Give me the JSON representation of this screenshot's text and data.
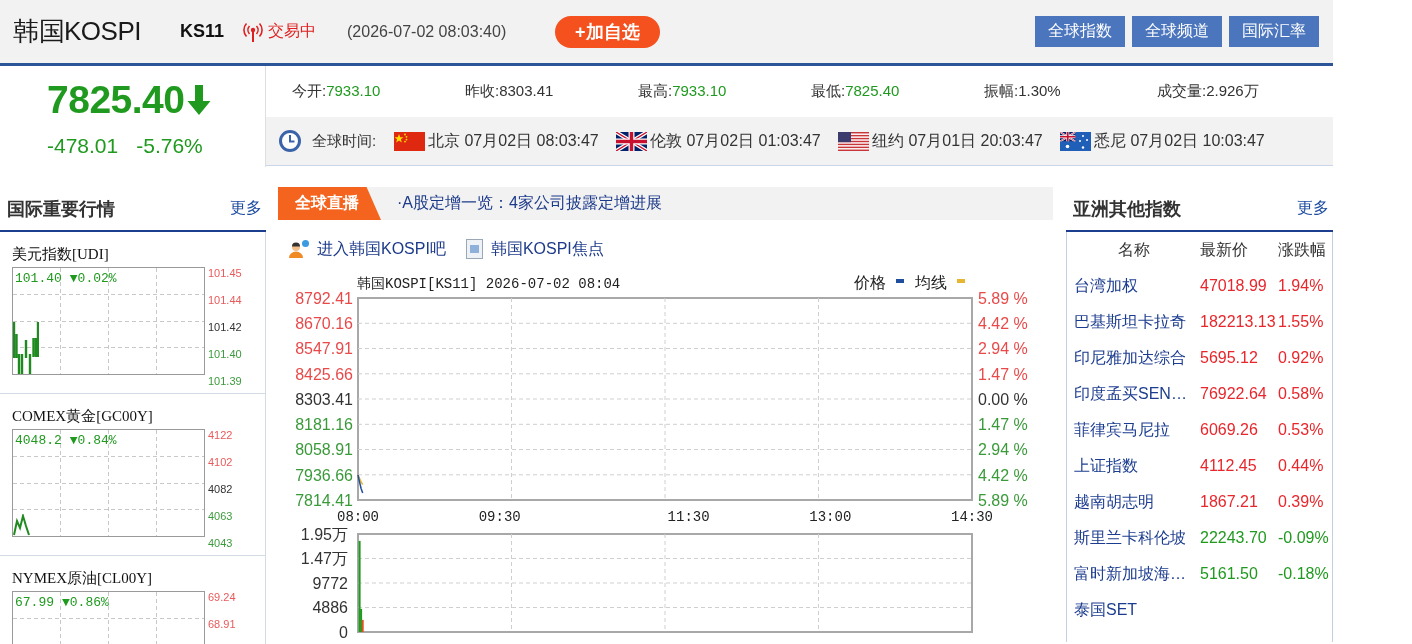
{
  "header": {
    "title": "韩国KOSPI",
    "code": "KS11",
    "status": "交易中",
    "timestamp": "(2026-07-02 08:03:40)",
    "watch_button": "+加自选",
    "nav_buttons": [
      "全球指数",
      "全球频道",
      "国际汇率"
    ]
  },
  "quote": {
    "price": "7825.40",
    "falling": true,
    "change": "-478.01",
    "change_percent": "-5.76%"
  },
  "stats": [
    {
      "label": "今开:",
      "value": "7933.10",
      "color": "#1f9a1f"
    },
    {
      "label": "昨收:",
      "value": "8303.41",
      "color": "#333333"
    },
    {
      "label": "最高:",
      "value": "7933.10",
      "color": "#1f9a1f"
    },
    {
      "label": "最低:",
      "value": "7825.40",
      "color": "#1f9a1f"
    },
    {
      "label": "振幅:",
      "value": "1.30%",
      "color": "#333333"
    },
    {
      "label": "成交量:",
      "value": "2.926万",
      "color": "#333333"
    }
  ],
  "world_clock": {
    "label": "全球时间:",
    "cities": [
      {
        "kind": "china",
        "text": "北京 07月02日 08:03:47"
      },
      {
        "kind": "uk",
        "text": "伦敦 07月02日 01:03:47"
      },
      {
        "kind": "us",
        "text": "纽约 07月01日 20:03:47"
      },
      {
        "kind": "australia",
        "text": "悉尼 07月02日 10:03:47"
      }
    ]
  },
  "markets_panel": {
    "title": "国际重要行情",
    "more": "更多",
    "cards": [
      {
        "name": "美元指数[UDI]",
        "price": "101.40",
        "change": "▼0.02%",
        "color": "#1f9a1f",
        "kind": "bars",
        "ticks": [
          {
            "label": "101.45",
            "color": "#e85a5a"
          },
          {
            "label": "101.44",
            "color": "#e85a5a"
          },
          {
            "label": "101.42",
            "color": "#333333"
          },
          {
            "label": "101.40",
            "color": "#3d9a3d"
          },
          {
            "label": "101.39",
            "color": "#3d9a3d"
          }
        ]
      },
      {
        "name": "COMEX黄金[GC00Y]",
        "price": "4048.2",
        "change": "▼0.84%",
        "color": "#1f9a1f",
        "kind": "line",
        "ticks": [
          {
            "label": "4122",
            "color": "#e85a5a"
          },
          {
            "label": "4102",
            "color": "#e85a5a"
          },
          {
            "label": "4082",
            "color": "#333333"
          },
          {
            "label": "4063",
            "color": "#3d9a3d"
          },
          {
            "label": "4043",
            "color": "#3d9a3d"
          }
        ]
      },
      {
        "name": "NYMEX原油[CL00Y]",
        "price": "67.99",
        "change": "▼0.86%",
        "color": "#1f9a1f",
        "kind": "empty",
        "ticks": [
          {
            "label": "69.24",
            "color": "#e85a5a"
          },
          {
            "label": "68.91",
            "color": "#e85a5a"
          }
        ]
      }
    ]
  },
  "news_bar": {
    "tag": "全球直播",
    "headline": "·A股定增一览：4家公司披露定增进展"
  },
  "links": [
    {
      "kind": "forum",
      "label": "进入韩国KOSPI吧"
    },
    {
      "kind": "news",
      "label": "韩国KOSPI焦点"
    }
  ],
  "price_chart": {
    "right_ticks": [
      "5.89 %",
      "4.42 %",
      "2.94 %",
      "1.47 %",
      "0.00 %",
      "1.47 %",
      "2.94 %",
      "4.42 %",
      "5.89 %"
    ],
    "chart_data": {
      "type": "line",
      "grid": true,
      "legend": "top-right",
      "title": "韩国KOSPI[KS11] 2026-07-02 08:04",
      "categories": [
        "08:00",
        null,
        null,
        null,
        null,
        null,
        null,
        null,
        null,
        null,
        null,
        null,
        null,
        null,
        null,
        null,
        null,
        null,
        null,
        null,
        null,
        null,
        null,
        null,
        null,
        null,
        null,
        null,
        null,
        null,
        null,
        null,
        null,
        null,
        null,
        null,
        null,
        null,
        null,
        null,
        null,
        null,
        null,
        null,
        null,
        null,
        null,
        null,
        null,
        null,
        null,
        null,
        null,
        null,
        null,
        null,
        null,
        null,
        null,
        null,
        null,
        null,
        null,
        null,
        null,
        null,
        null,
        null,
        null,
        null,
        null,
        null,
        null,
        null,
        null,
        null,
        null,
        null,
        null,
        null,
        null,
        null,
        null,
        null,
        null,
        null,
        null,
        null,
        null,
        null,
        "09:30",
        null,
        null,
        null,
        null,
        null,
        null,
        null,
        null,
        null,
        null,
        null,
        null,
        null,
        null,
        null,
        null,
        null,
        null,
        null,
        null,
        null,
        null,
        null,
        null,
        null,
        null,
        null,
        null,
        null,
        null,
        null,
        null,
        null,
        null,
        null,
        null,
        null,
        null,
        null,
        null,
        null,
        null,
        null,
        null,
        null,
        null,
        null,
        null,
        null,
        null,
        null,
        null,
        null,
        null,
        null,
        null,
        null,
        null,
        null,
        null,
        null,
        null,
        null,
        null,
        null,
        null,
        null,
        null,
        null,
        null,
        null,
        null,
        null,
        null,
        null,
        null,
        null,
        null,
        null,
        null,
        null,
        null,
        null,
        null,
        null,
        null,
        null,
        null,
        null,
        null,
        null,
        null,
        null,
        null,
        null,
        null,
        null,
        null,
        null,
        null,
        null,
        null,
        null,
        null,
        null,
        null,
        null,
        null,
        null,
        null,
        null,
        null,
        null,
        null,
        null,
        null,
        null,
        null,
        null,
        "11:30",
        null,
        null,
        null,
        null,
        null,
        null,
        null,
        null,
        null,
        null,
        null,
        null,
        null,
        null,
        null,
        null,
        null,
        null,
        null,
        null,
        null,
        null,
        null,
        null,
        null,
        null,
        null,
        null,
        null,
        null,
        null,
        null,
        null,
        null,
        null,
        null,
        null,
        null,
        null,
        null,
        null,
        null,
        null,
        null,
        null,
        null,
        null,
        null,
        null,
        null,
        null,
        null,
        null,
        null,
        null,
        null,
        null,
        null,
        null,
        null,
        null,
        null,
        null,
        null,
        null,
        null,
        null,
        null,
        null,
        null,
        null,
        null,
        null,
        null,
        null,
        null,
        null,
        null,
        null,
        null,
        null,
        null,
        null,
        null,
        null,
        null,
        null,
        null,
        null,
        "13:00",
        null,
        null,
        null,
        null,
        null,
        null,
        null,
        null,
        null,
        null,
        null,
        null,
        null,
        null,
        null,
        null,
        null,
        null,
        null,
        null,
        null,
        null,
        null,
        null,
        null,
        null,
        null,
        null,
        null,
        null,
        null,
        null,
        null,
        null,
        null,
        null,
        null,
        null,
        null,
        null,
        null,
        null,
        null,
        null,
        null,
        null,
        null,
        null,
        null,
        null,
        null,
        null,
        null,
        null,
        null,
        null,
        null,
        null,
        null,
        null,
        null,
        null,
        null,
        null,
        null,
        null,
        null,
        null,
        null,
        null,
        null,
        null,
        null,
        null,
        null,
        null,
        null,
        null,
        null,
        null,
        null,
        null,
        null,
        null,
        null,
        null,
        null,
        null,
        null,
        "14:30"
      ],
      "series": [
        {
          "name": "价格",
          "color": "#1f4e9e",
          "values": [
            7936,
            7900,
            7870,
            7848,
            null,
            null,
            null,
            null,
            null,
            null,
            null,
            null,
            null,
            null,
            null,
            null,
            null,
            null,
            null,
            null,
            null,
            null,
            null,
            null,
            null,
            null,
            null,
            null,
            null,
            null,
            null,
            null,
            null,
            null,
            null,
            null,
            null,
            null,
            null,
            null,
            null,
            null,
            null,
            null,
            null,
            null,
            null,
            null,
            null,
            null,
            null,
            null,
            null,
            null,
            null,
            null,
            null,
            null,
            null,
            null,
            null,
            null,
            null,
            null,
            null,
            null,
            null,
            null,
            null,
            null,
            null,
            null,
            null,
            null,
            null,
            null,
            null,
            null,
            null,
            null,
            null,
            null,
            null,
            null,
            null,
            null,
            null,
            null,
            null,
            null,
            null,
            null,
            null,
            null,
            null,
            null,
            null,
            null,
            null,
            null,
            null,
            null,
            null,
            null,
            null,
            null,
            null,
            null,
            null,
            null,
            null,
            null,
            null,
            null,
            null,
            null,
            null,
            null,
            null,
            null,
            null,
            null,
            null,
            null,
            null,
            null,
            null,
            null,
            null,
            null,
            null,
            null,
            null,
            null,
            null,
            null,
            null,
            null,
            null,
            null,
            null,
            null,
            null,
            null,
            null,
            null,
            null,
            null,
            null,
            null,
            null,
            null,
            null,
            null,
            null,
            null,
            null,
            null,
            null,
            null,
            null,
            null,
            null,
            null,
            null,
            null,
            null,
            null,
            null,
            null,
            null,
            null,
            null,
            null,
            null,
            null,
            null,
            null,
            null,
            null,
            null,
            null,
            null,
            null,
            null,
            null,
            null,
            null,
            null,
            null,
            null,
            null,
            null,
            null,
            null,
            null,
            null,
            null,
            null,
            null,
            null,
            null,
            null,
            null,
            null,
            null,
            null,
            null,
            null,
            null,
            null,
            null,
            null,
            null,
            null,
            null,
            null,
            null,
            null,
            null,
            null,
            null,
            null,
            null,
            null,
            null,
            null,
            null,
            null,
            null,
            null,
            null,
            null,
            null,
            null,
            null,
            null,
            null,
            null,
            null,
            null,
            null,
            null,
            null,
            null,
            null,
            null,
            null,
            null,
            null,
            null,
            null,
            null,
            null,
            null,
            null,
            null,
            null,
            null,
            null,
            null,
            null,
            null,
            null,
            null,
            null,
            null,
            null,
            null,
            null,
            null,
            null,
            null,
            null,
            null,
            null,
            null,
            null,
            null,
            null,
            null,
            null,
            null,
            null,
            null,
            null,
            null,
            null,
            null,
            null,
            null,
            null,
            null,
            null,
            null,
            null,
            null,
            null,
            null,
            null,
            null,
            null,
            null,
            null,
            null,
            null,
            null,
            null,
            null,
            null,
            null,
            null,
            null,
            null,
            null,
            null,
            null,
            null,
            null,
            null,
            null,
            null,
            null,
            null,
            null,
            null,
            null,
            null,
            null,
            null,
            null,
            null,
            null,
            null,
            null,
            null,
            null,
            null,
            null,
            null,
            null,
            null,
            null,
            null,
            null,
            null,
            null,
            null,
            null,
            null,
            null,
            null,
            null,
            null,
            null,
            null,
            null,
            null,
            null,
            null,
            null,
            null,
            null,
            null,
            null,
            null,
            null,
            null,
            null,
            null,
            null,
            null,
            null,
            null,
            null,
            null,
            null,
            null,
            null,
            null,
            null,
            null,
            null,
            null,
            null,
            null,
            null,
            null,
            null,
            null,
            null
          ]
        },
        {
          "name": "均线",
          "color": "#e8b530",
          "values": [
            7936,
            7918,
            7902,
            7889,
            null,
            null,
            null,
            null,
            null,
            null,
            null,
            null,
            null,
            null,
            null,
            null,
            null,
            null,
            null,
            null,
            null,
            null,
            null,
            null,
            null,
            null,
            null,
            null,
            null,
            null,
            null,
            null,
            null,
            null,
            null,
            null,
            null,
            null,
            null,
            null,
            null,
            null,
            null,
            null,
            null,
            null,
            null,
            null,
            null,
            null,
            null,
            null,
            null,
            null,
            null,
            null,
            null,
            null,
            null,
            null,
            null,
            null,
            null,
            null,
            null,
            null,
            null,
            null,
            null,
            null,
            null,
            null,
            null,
            null,
            null,
            null,
            null,
            null,
            null,
            null,
            null,
            null,
            null,
            null,
            null,
            null,
            null,
            null,
            null,
            null,
            null,
            null,
            null,
            null,
            null,
            null,
            null,
            null,
            null,
            null,
            null,
            null,
            null,
            null,
            null,
            null,
            null,
            null,
            null,
            null,
            null,
            null,
            null,
            null,
            null,
            null,
            null,
            null,
            null,
            null,
            null,
            null,
            null,
            null,
            null,
            null,
            null,
            null,
            null,
            null,
            null,
            null,
            null,
            null,
            null,
            null,
            null,
            null,
            null,
            null,
            null,
            null,
            null,
            null,
            null,
            null,
            null,
            null,
            null,
            null,
            null,
            null,
            null,
            null,
            null,
            null,
            null,
            null,
            null,
            null,
            null,
            null,
            null,
            null,
            null,
            null,
            null,
            null,
            null,
            null,
            null,
            null,
            null,
            null,
            null,
            null,
            null,
            null,
            null,
            null,
            null,
            null,
            null,
            null,
            null,
            null,
            null,
            null,
            null,
            null,
            null,
            null,
            null,
            null,
            null,
            null,
            null,
            null,
            null,
            null,
            null,
            null,
            null,
            null,
            null,
            null,
            null,
            null,
            null,
            null,
            null,
            null,
            null,
            null,
            null,
            null,
            null,
            null,
            null,
            null,
            null,
            null,
            null,
            null,
            null,
            null,
            null,
            null,
            null,
            null,
            null,
            null,
            null,
            null,
            null,
            null,
            null,
            null,
            null,
            null,
            null,
            null,
            null,
            null,
            null,
            null,
            null,
            null,
            null,
            null,
            null,
            null,
            null,
            null,
            null,
            null,
            null,
            null,
            null,
            null,
            null,
            null,
            null,
            null,
            null,
            null,
            null,
            null,
            null,
            null,
            null,
            null,
            null,
            null,
            null,
            null,
            null,
            null,
            null,
            null,
            null,
            null,
            null,
            null,
            null,
            null,
            null,
            null,
            null,
            null,
            null,
            null,
            null,
            null,
            null,
            null,
            null,
            null,
            null,
            null,
            null,
            null,
            null,
            null,
            null,
            null,
            null,
            null,
            null,
            null,
            null,
            null,
            null,
            null,
            null,
            null,
            null,
            null,
            null,
            null,
            null,
            null,
            null,
            null,
            null,
            null,
            null,
            null,
            null,
            null,
            null,
            null,
            null,
            null,
            null,
            null,
            null,
            null,
            null,
            null,
            null,
            null,
            null,
            null,
            null,
            null,
            null,
            null,
            null,
            null,
            null,
            null,
            null,
            null,
            null,
            null,
            null,
            null,
            null,
            null,
            null,
            null,
            null,
            null,
            null,
            null,
            null,
            null,
            null,
            null,
            null,
            null,
            null,
            null,
            null,
            null,
            null,
            null,
            null,
            null,
            null,
            null,
            null,
            null,
            null,
            null,
            null,
            null,
            null,
            null,
            null
          ]
        }
      ],
      "ylim": [
        7814.41,
        8792.41
      ],
      "yticks": [
        8792.41,
        8670.16,
        8547.91,
        8425.66,
        8303.41,
        8181.16,
        8058.91,
        7936.66,
        7814.41
      ]
    }
  },
  "volume_chart": {
    "y_labels": [
      "1.95万",
      "1.47万",
      "9772",
      "4886",
      "0"
    ]
  },
  "asia_panel": {
    "title": "亚洲其他指数",
    "more": "更多",
    "columns": [
      "名称",
      "最新价",
      "涨跌幅"
    ],
    "rows": [
      {
        "name": "台湾加权",
        "price": "47018.99",
        "change": "1.94%",
        "color": "#e8262b"
      },
      {
        "name": "巴基斯坦卡拉奇",
        "price": "182213.13",
        "change": "1.55%",
        "color": "#e8262b"
      },
      {
        "name": "印尼雅加达综合",
        "price": "5695.12",
        "change": "0.92%",
        "color": "#e8262b"
      },
      {
        "name": "印度孟买SEN…",
        "price": "76922.64",
        "change": "0.58%",
        "color": "#e8262b"
      },
      {
        "name": "菲律宾马尼拉",
        "price": "6069.26",
        "change": "0.53%",
        "color": "#e8262b"
      },
      {
        "name": "上证指数",
        "price": "4112.45",
        "change": "0.44%",
        "color": "#e8262b"
      },
      {
        "name": "越南胡志明",
        "price": "1867.21",
        "change": "0.39%",
        "color": "#e8262b"
      },
      {
        "name": "斯里兰卡科伦坡",
        "price": "22243.70",
        "change": "-0.09%",
        "color": "#1f9a1f"
      },
      {
        "name": "富时新加坡海…",
        "price": "5161.50",
        "change": "-0.18%",
        "color": "#1f9a1f"
      },
      {
        "name": "泰国SET"
      }
    ]
  }
}
